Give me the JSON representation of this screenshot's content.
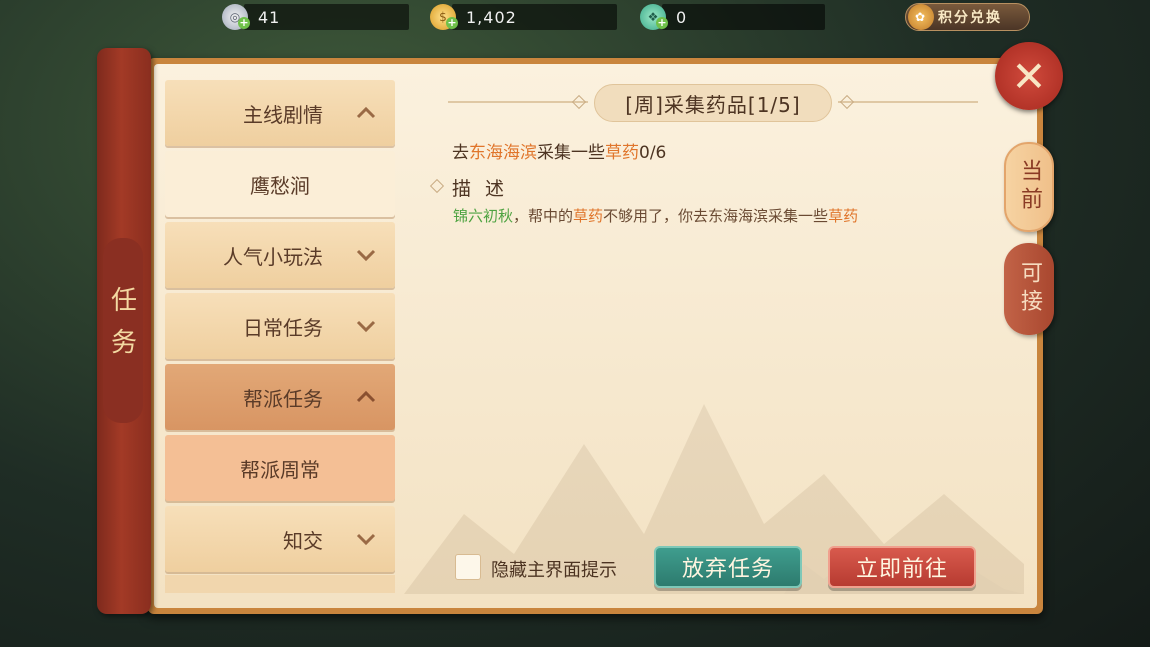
{
  "currencies": [
    {
      "name": "silver",
      "icon": "silver-coin-icon",
      "value": "41"
    },
    {
      "name": "gold",
      "icon": "gold-coin-icon",
      "value": "1,402"
    },
    {
      "name": "jade",
      "icon": "jade-icon",
      "value": "0"
    }
  ],
  "exchange_label": "积分兑换",
  "panel_title": "任务",
  "categories": [
    {
      "label": "主线剧情",
      "expanded": true
    },
    {
      "label": "鹰愁涧",
      "sub": true
    },
    {
      "label": "人气小玩法",
      "expanded": false
    },
    {
      "label": "日常任务",
      "expanded": false
    },
    {
      "label": "帮派任务",
      "expanded": true,
      "active": true
    },
    {
      "label": "帮派周常",
      "sub": true,
      "active": true
    },
    {
      "label": "知交",
      "expanded": false
    }
  ],
  "quest": {
    "title": "[周]采集药品[1/5]",
    "objective_parts": [
      "去",
      "东海海滨",
      "采集一些",
      "草药",
      "0/6"
    ],
    "desc_heading": "描 述",
    "desc_parts": [
      "锦六初秋",
      "，帮中的",
      "草药",
      "不够用了，你去东海海滨采集一些",
      "草药"
    ]
  },
  "tabs": {
    "current": "当前",
    "available": "可接"
  },
  "hide_hint_label": "隐藏主界面提示",
  "buttons": {
    "abandon": "放弃任务",
    "go": "立即前往"
  },
  "colors": {
    "highlight": "#e0752b",
    "npc": "#4fa342",
    "accent_red": "#b73b31",
    "accent_teal": "#2d7b6e"
  }
}
